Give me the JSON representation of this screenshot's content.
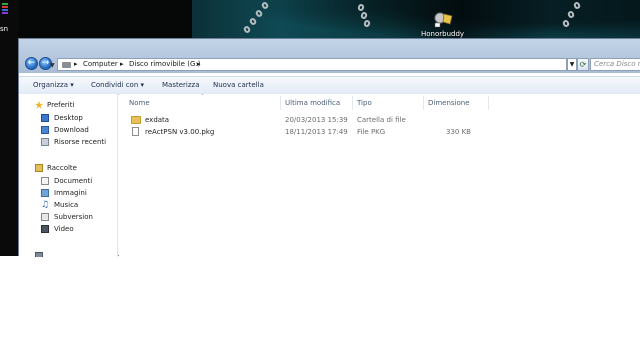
{
  "desktop": {
    "left_strip_text": "sn",
    "shortcut_label": "Honorbuddy"
  },
  "address": {
    "crumbs": [
      "Computer",
      "Disco rimovibile (G:)"
    ],
    "search_placeholder": "Cerca Disco rimo"
  },
  "toolbar": {
    "organize": "Organizza",
    "share": "Condividi con",
    "burn": "Masterizza",
    "new_folder": "Nuova cartella"
  },
  "nav": {
    "favorites_label": "Preferiti",
    "favorites": [
      "Desktop",
      "Download",
      "Risorse recenti"
    ],
    "libraries_label": "Raccolte",
    "libraries": [
      "Documenti",
      "Immagini",
      "Musica",
      "Subversion",
      "Video"
    ]
  },
  "columns": {
    "name": "Nome",
    "modified": "Ultima modifica",
    "type": "Tipo",
    "size": "Dimensione"
  },
  "files": [
    {
      "name": "exdata",
      "modified": "20/03/2013 15:39",
      "type": "Cartella di file",
      "size": "",
      "kind": "folder"
    },
    {
      "name": "reActPSN v3.00.pkg",
      "modified": "18/11/2013 17:49",
      "type": "File PKG",
      "size": "330 KB",
      "kind": "file"
    }
  ]
}
